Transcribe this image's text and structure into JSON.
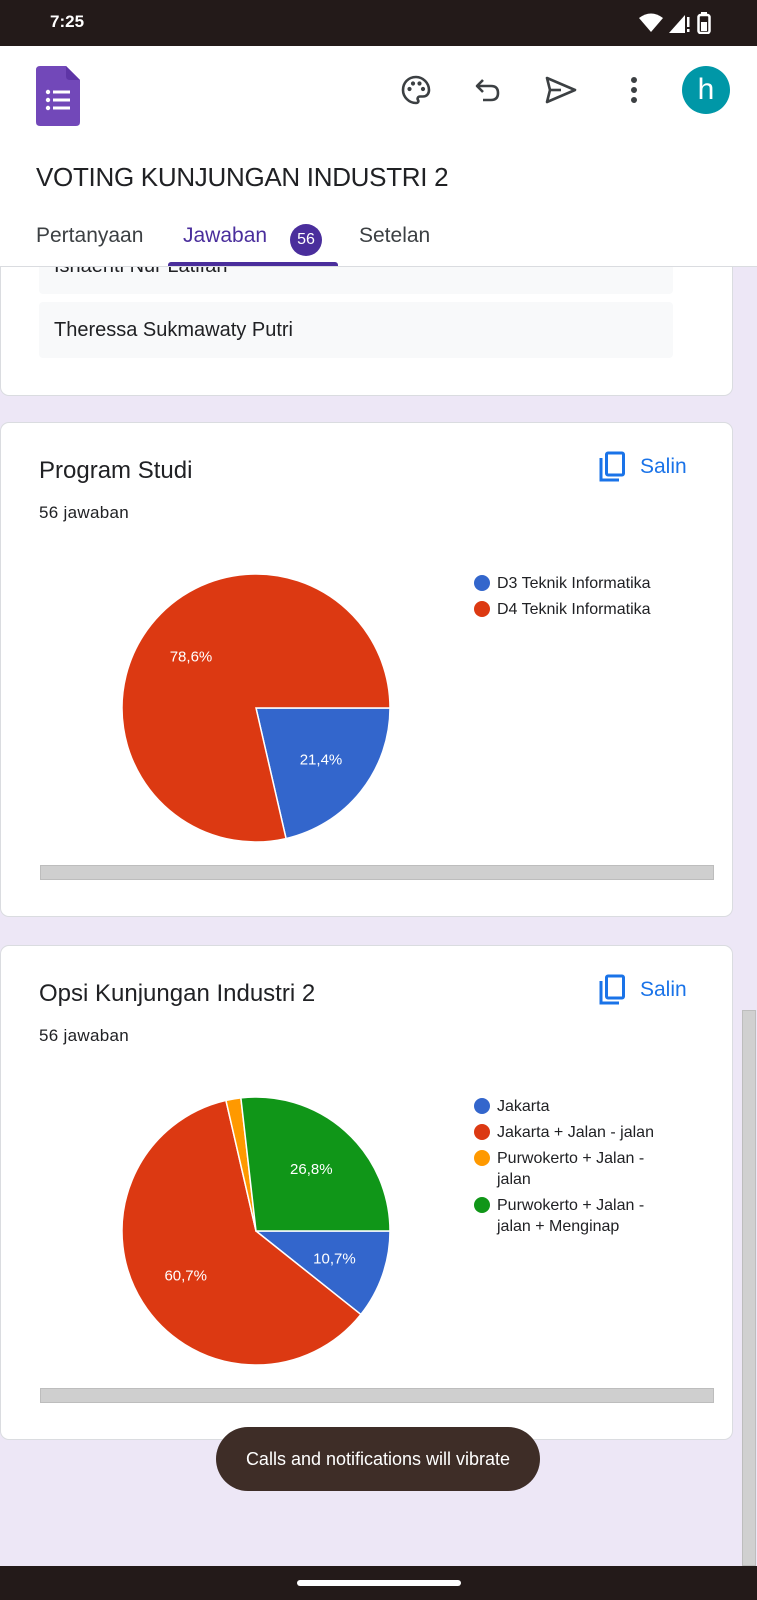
{
  "status_bar": {
    "time": "7:25"
  },
  "header": {
    "title": "VOTING KUNJUNGAN INDUSTRI 2",
    "avatar_letter": "h",
    "tabs": [
      {
        "label": "Pertanyaan"
      },
      {
        "label": "Jawaban",
        "badge": "56",
        "active": true
      },
      {
        "label": "Setelan"
      }
    ]
  },
  "names_card": {
    "rows": [
      "Ishaenti Nur Latifah",
      "Theressa Sukmawaty Putri"
    ]
  },
  "questions": [
    {
      "title": "Program Studi",
      "count": "56 jawaban",
      "copy_label": "Salin",
      "legend": [
        {
          "label": "D3 Teknik Informatika",
          "color": "#3366cc"
        },
        {
          "label": "D4 Teknik Informatika",
          "color": "#dc3912"
        }
      ]
    },
    {
      "title": "Opsi Kunjungan Industri 2",
      "count": "56 jawaban",
      "copy_label": "Salin",
      "legend": [
        {
          "label": "Jakarta",
          "color": "#3366cc"
        },
        {
          "label": "Jakarta + Jalan - jalan",
          "color": "#dc3912"
        },
        {
          "label": "Purwokerto + Jalan - jalan",
          "color": "#ff9900"
        },
        {
          "label": "Purwokerto + Jalan - jalan + Menginap",
          "color": "#109618"
        }
      ]
    }
  ],
  "chart_data": [
    {
      "type": "pie",
      "title": "Program Studi",
      "categories": [
        "D3 Teknik Informatika",
        "D4 Teknik Informatika"
      ],
      "values": [
        21.4,
        78.6
      ],
      "labels": [
        "21,4%",
        "78,6%"
      ],
      "colors": [
        "#3366cc",
        "#dc3912"
      ],
      "legend": "right"
    },
    {
      "type": "pie",
      "title": "Opsi Kunjungan Industri 2",
      "categories": [
        "Jakarta",
        "Jakarta + Jalan - jalan",
        "Purwokerto + Jalan - jalan",
        "Purwokerto + Jalan - jalan + Menginap"
      ],
      "values": [
        10.7,
        60.7,
        1.8,
        26.8
      ],
      "labels": [
        "10,7%",
        "60,7%",
        "",
        "26,8%"
      ],
      "colors": [
        "#3366cc",
        "#dc3912",
        "#ff9900",
        "#109618"
      ],
      "legend": "right"
    }
  ],
  "toast": {
    "message": "Calls and notifications will vibrate"
  }
}
